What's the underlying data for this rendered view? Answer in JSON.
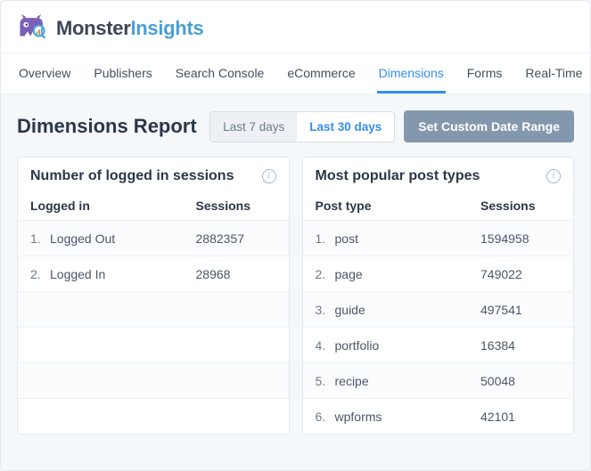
{
  "brand": {
    "part1": "Monster",
    "part2": "Insights"
  },
  "tabs": [
    {
      "label": "Overview"
    },
    {
      "label": "Publishers"
    },
    {
      "label": "Search Console"
    },
    {
      "label": "eCommerce"
    },
    {
      "label": "Dimensions"
    },
    {
      "label": "Forms"
    },
    {
      "label": "Real-Time"
    }
  ],
  "active_tab_index": 4,
  "page_title": "Dimensions Report",
  "range": {
    "buttons": [
      {
        "label": "Last 7 days"
      },
      {
        "label": "Last 30 days"
      }
    ],
    "active_index": 1,
    "custom_label": "Set Custom Date Range"
  },
  "cards": {
    "left": {
      "title": "Number of logged in sessions",
      "col_label": "Logged in",
      "col_value": "Sessions",
      "rows": [
        {
          "n": "1.",
          "label": "Logged Out",
          "value": "2882357"
        },
        {
          "n": "2.",
          "label": "Logged In",
          "value": "28968"
        }
      ]
    },
    "right": {
      "title": "Most popular post types",
      "col_label": "Post type",
      "col_value": "Sessions",
      "rows": [
        {
          "n": "1.",
          "label": "post",
          "value": "1594958"
        },
        {
          "n": "2.",
          "label": "page",
          "value": "749022"
        },
        {
          "n": "3.",
          "label": "guide",
          "value": "497541"
        },
        {
          "n": "4.",
          "label": "portfolio",
          "value": "16384"
        },
        {
          "n": "5.",
          "label": "recipe",
          "value": "50048"
        },
        {
          "n": "6.",
          "label": "wpforms",
          "value": "42101"
        }
      ]
    }
  }
}
